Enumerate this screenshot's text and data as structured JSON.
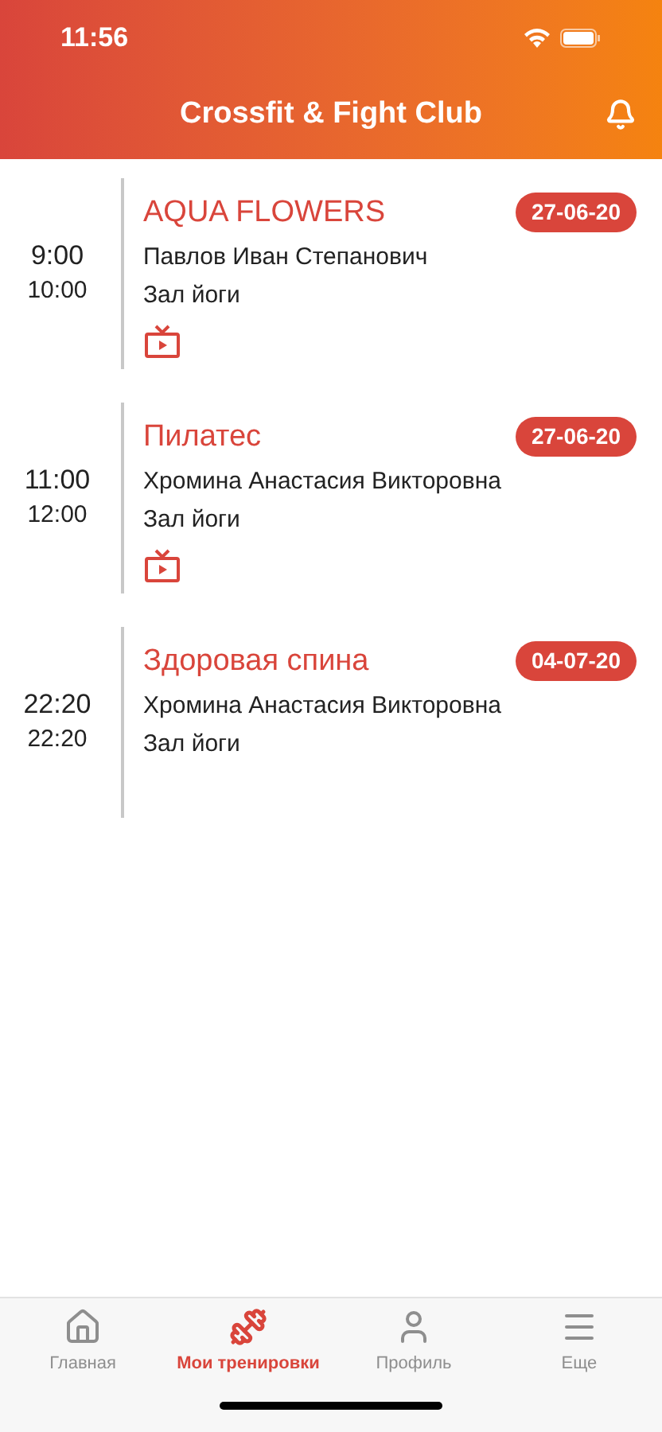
{
  "status_bar": {
    "time": "11:56"
  },
  "header": {
    "title": "Crossfit & Fight Club"
  },
  "sessions": [
    {
      "start": "9:00",
      "end": "10:00",
      "title": "AQUA FLOWERS",
      "date": "27-06-20",
      "trainer": "Павлов Иван Степанович",
      "room": "Зал йоги",
      "video": true
    },
    {
      "start": "11:00",
      "end": "12:00",
      "title": "Пилатес",
      "date": "27-06-20",
      "trainer": "Хромина Анастасия Викторовна",
      "room": "Зал йоги",
      "video": true
    },
    {
      "start": "22:20",
      "end": "22:20",
      "title": "Здоровая спина",
      "date": "04-07-20",
      "trainer": "Хромина Анастасия Викторовна",
      "room": "Зал йоги",
      "video": false
    }
  ],
  "tabs": [
    {
      "kind": "home",
      "label": "Главная",
      "selected": false
    },
    {
      "kind": "workouts",
      "label": "Мои тренировки",
      "selected": true
    },
    {
      "kind": "profile",
      "label": "Профиль",
      "selected": false
    },
    {
      "kind": "more",
      "label": "Еще",
      "selected": false
    }
  ]
}
